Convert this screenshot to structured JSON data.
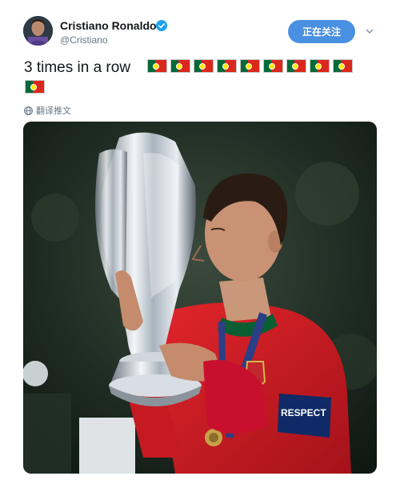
{
  "tweet": {
    "display_name": "Cristiano Ronaldo",
    "handle": "@Cristiano",
    "text": "3 times in a row",
    "flag_count": 10,
    "follow_label": "正在关注",
    "translate_label": "翻译推文",
    "armband_text": "RESPECT"
  },
  "icons": {
    "verified": "verified-badge-icon",
    "caret": "chevron-down-icon",
    "translate": "globe-icon",
    "flag": "portugal-flag-emoji"
  },
  "colors": {
    "follow_button": "#4a90e2",
    "verified": "#1da1f2",
    "jersey": "#c8102e",
    "background_dark": "#1c2a22"
  }
}
